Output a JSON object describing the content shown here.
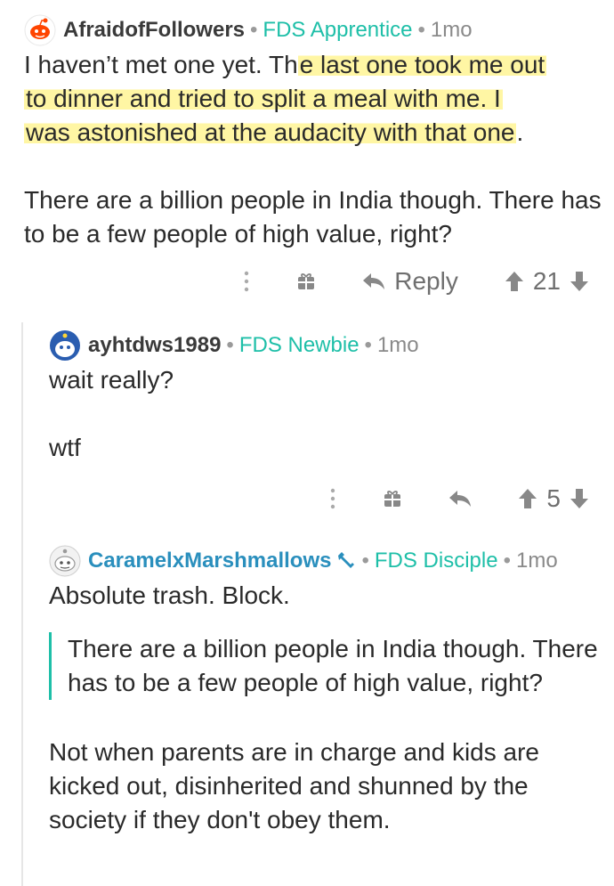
{
  "comments": [
    {
      "username": "AfraidofFollowers",
      "flair": "FDS Apprentice",
      "age": "1mo",
      "line1_pre": "I haven’t met one yet. Th",
      "line1_hl": "e last one took me out",
      "line2_hl": "to dinner and tried to split a meal with me. I",
      "line3_hl": "was astonished at the audacity with that one",
      "line3_post": ".",
      "para2": "There are a billion people in India though. There has to be a few people of high value, right?",
      "reply_label": "Reply",
      "score": "21"
    },
    {
      "username": "ayhtdws1989",
      "flair": "FDS Newbie",
      "age": "1mo",
      "para1": "wait really?",
      "para2": "wtf",
      "score": "5"
    },
    {
      "username": "CaramelxMarshmallows",
      "flair": "FDS Disciple",
      "age": "1mo",
      "para1": "Absolute trash. Block.",
      "quote": "There are a billion people in India though. There has to be a few people of high value, right?",
      "para2": "Not when parents are in charge and kids are kicked out, disinherited and shunned by the society if they don't obey them."
    }
  ],
  "separator": "•",
  "icons": {
    "more": "more-vertical-icon",
    "gift": "gift-icon",
    "reply": "reply-arrow-icon",
    "upvote": "upvote-arrow-icon",
    "downvote": "downvote-arrow-icon",
    "mod": "moderator-wrench-icon"
  },
  "colors": {
    "flair": "#1ebfa8",
    "username": "#3a3a3a",
    "highlight": "#ffee5a",
    "quote_bar": "#1ebfa8"
  }
}
